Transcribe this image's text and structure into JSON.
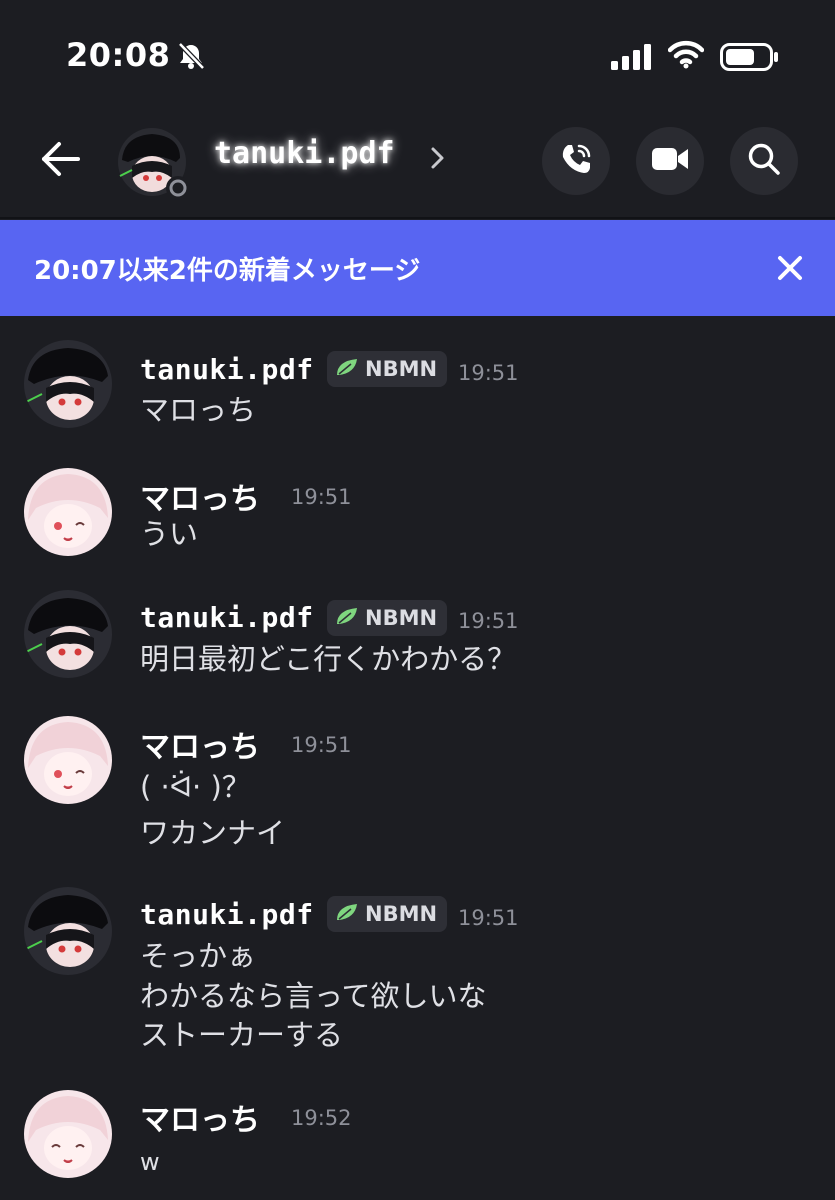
{
  "status_bar": {
    "time": "20:08"
  },
  "header": {
    "name": "tanuki.pdf"
  },
  "banner": {
    "text": "20:07以来2件の新着メッセージ"
  },
  "colors": {
    "accent": "#5865f2",
    "background": "#1c1d22",
    "badge_bg": "#2e2f36",
    "timestamp": "#8e9099"
  },
  "messages": [
    {
      "author": "tanuki.pdf",
      "badge": "NBMN",
      "time": "19:51",
      "lines": [
        "マロっち"
      ]
    },
    {
      "author": "マロっち",
      "time": "19:51",
      "lines": [
        "うい"
      ]
    },
    {
      "author": "tanuki.pdf",
      "badge": "NBMN",
      "time": "19:51",
      "lines": [
        "明日最初どこ行くかわかる？"
      ]
    },
    {
      "author": "マロっち",
      "time": "19:51",
      "lines": [
        "( ·ᐛ· )？",
        "ワカンナイ"
      ]
    },
    {
      "author": "tanuki.pdf",
      "badge": "NBMN",
      "time": "19:51",
      "lines": [
        "そっかぁ",
        "わかるなら言って欲しいな",
        "ストーカーする"
      ]
    },
    {
      "author": "マロっち",
      "time": "19:52",
      "lines": [
        "w"
      ]
    }
  ],
  "icons": {
    "back": "arrow-left-icon",
    "call": "phone-icon",
    "video": "video-camera-icon",
    "search": "search-icon",
    "close": "close-icon",
    "badge": "leaf-icon",
    "mute": "bell-slash-icon"
  }
}
